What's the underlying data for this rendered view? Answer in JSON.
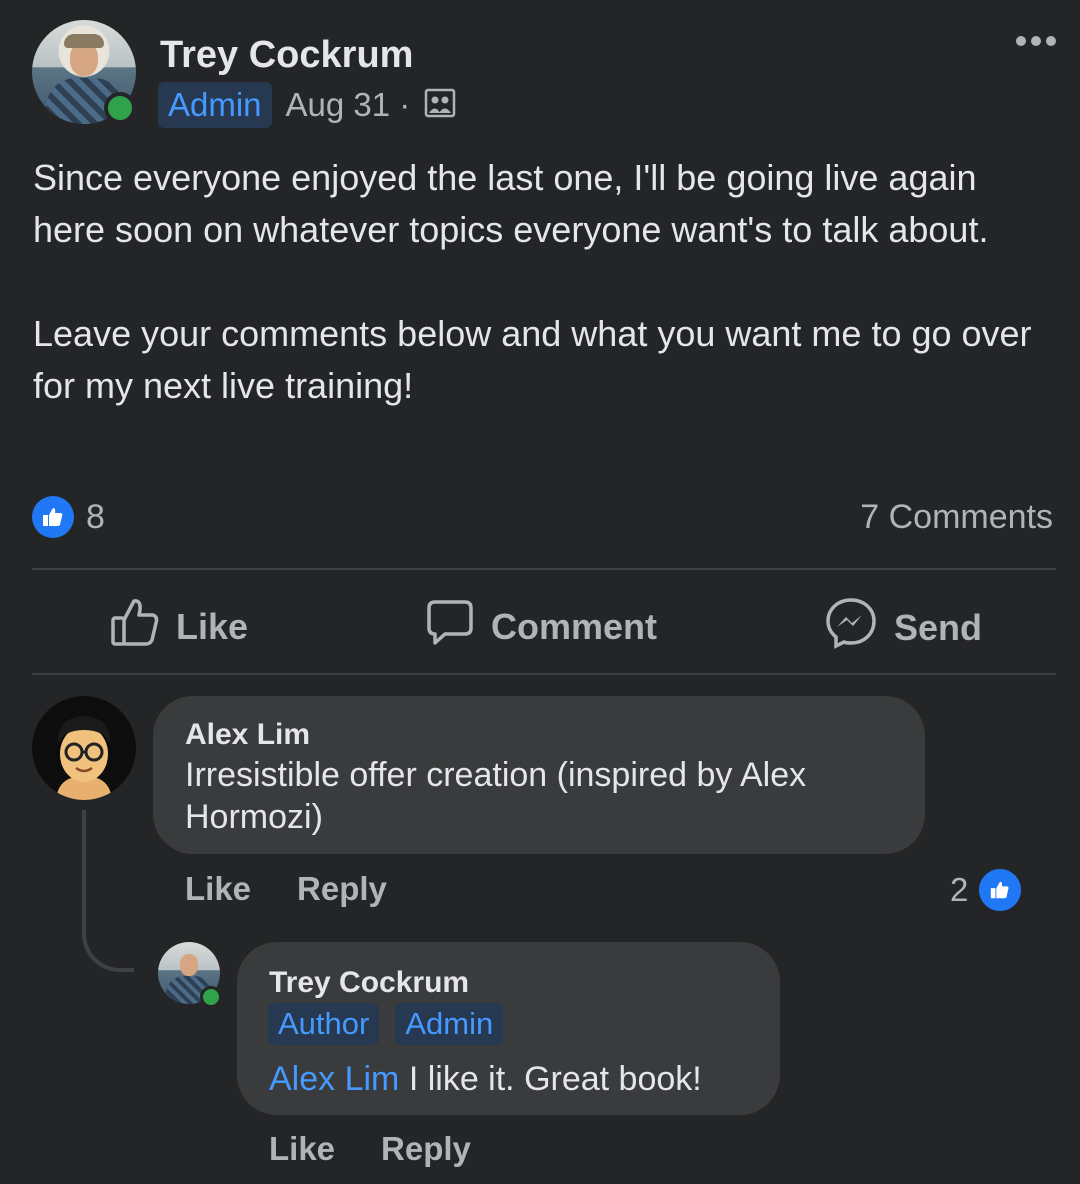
{
  "post": {
    "author": "Trey Cockrum",
    "badge": "Admin",
    "date": "Aug 31 ·",
    "text": "Since everyone enjoyed the last one, I'll be going live again here soon on whatever topics everyone want's to talk about.\n\nLeave your comments below and what you want me to go over for my next live training!",
    "reaction_count": "8",
    "comments_count": "7 Comments",
    "audience_icon": "group-audience-icon"
  },
  "actions": {
    "like": "Like",
    "comment": "Comment",
    "send": "Send"
  },
  "comments": [
    {
      "name": "Alex Lim",
      "text": "Irresistible offer creation (inspired by Alex Hormozi)",
      "like": "Like",
      "reply": "Reply",
      "reaction_count": "2"
    }
  ],
  "reply": {
    "name": "Trey Cockrum",
    "badges": [
      "Author",
      "Admin"
    ],
    "mention": "Alex Lim",
    "text": "I like it. Great book!",
    "like": "Like",
    "reply": "Reply"
  },
  "colors": {
    "background": "#242526",
    "bubble": "#3a3b3c",
    "accent": "#4599ff",
    "like_blue": "#2078f4",
    "online": "#31a24c"
  }
}
